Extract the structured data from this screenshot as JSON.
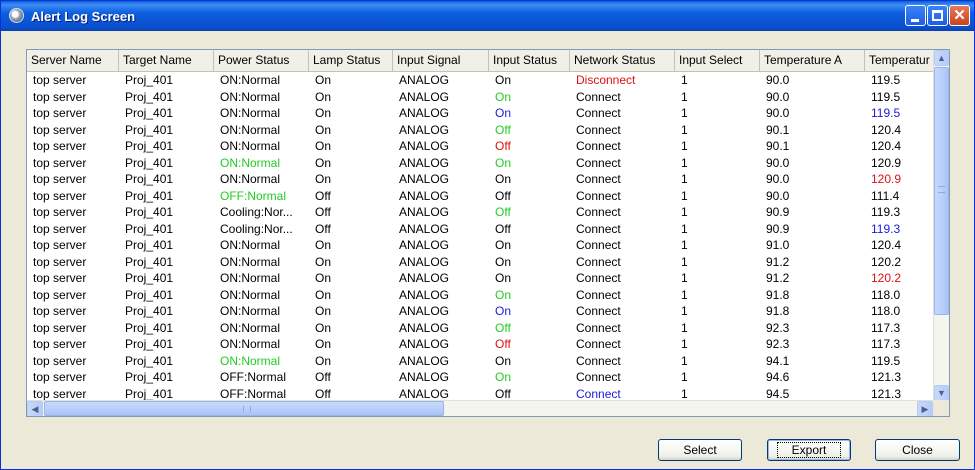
{
  "window": {
    "title": "Alert Log Screen"
  },
  "columns": [
    "Server Name",
    "Target Name",
    "Power Status",
    "Lamp Status",
    "Input Signal",
    "Input Status",
    "Network Status",
    "Input Select",
    "Temperature A",
    "Temperatur"
  ],
  "rows": [
    [
      "top server",
      "Proj_401",
      "ON:Normal",
      "On",
      "ANALOG",
      "On",
      "Disconnect",
      "1",
      "90.0",
      "119.5"
    ],
    [
      "top server",
      "Proj_401",
      "ON:Normal",
      "On",
      "ANALOG",
      "On",
      "Connect",
      "1",
      "90.0",
      "119.5"
    ],
    [
      "top server",
      "Proj_401",
      "ON:Normal",
      "On",
      "ANALOG",
      "On",
      "Connect",
      "1",
      "90.0",
      "119.5"
    ],
    [
      "top server",
      "Proj_401",
      "ON:Normal",
      "On",
      "ANALOG",
      "Off",
      "Connect",
      "1",
      "90.1",
      "120.4"
    ],
    [
      "top server",
      "Proj_401",
      "ON:Normal",
      "On",
      "ANALOG",
      "Off",
      "Connect",
      "1",
      "90.1",
      "120.4"
    ],
    [
      "top server",
      "Proj_401",
      "ON:Normal",
      "On",
      "ANALOG",
      "On",
      "Connect",
      "1",
      "90.0",
      "120.9"
    ],
    [
      "top server",
      "Proj_401",
      "ON:Normal",
      "On",
      "ANALOG",
      "On",
      "Connect",
      "1",
      "90.0",
      "120.9"
    ],
    [
      "top server",
      "Proj_401",
      "OFF:Normal",
      "Off",
      "ANALOG",
      "Off",
      "Connect",
      "1",
      "90.0",
      "111.4"
    ],
    [
      "top server",
      "Proj_401",
      "Cooling:Nor...",
      "Off",
      "ANALOG",
      "Off",
      "Connect",
      "1",
      "90.9",
      "119.3"
    ],
    [
      "top server",
      "Proj_401",
      "Cooling:Nor...",
      "Off",
      "ANALOG",
      "Off",
      "Connect",
      "1",
      "90.9",
      "119.3"
    ],
    [
      "top server",
      "Proj_401",
      "ON:Normal",
      "On",
      "ANALOG",
      "On",
      "Connect",
      "1",
      "91.0",
      "120.4"
    ],
    [
      "top server",
      "Proj_401",
      "ON:Normal",
      "On",
      "ANALOG",
      "On",
      "Connect",
      "1",
      "91.2",
      "120.2"
    ],
    [
      "top server",
      "Proj_401",
      "ON:Normal",
      "On",
      "ANALOG",
      "On",
      "Connect",
      "1",
      "91.2",
      "120.2"
    ],
    [
      "top server",
      "Proj_401",
      "ON:Normal",
      "On",
      "ANALOG",
      "On",
      "Connect",
      "1",
      "91.8",
      "118.0"
    ],
    [
      "top server",
      "Proj_401",
      "ON:Normal",
      "On",
      "ANALOG",
      "On",
      "Connect",
      "1",
      "91.8",
      "118.0"
    ],
    [
      "top server",
      "Proj_401",
      "ON:Normal",
      "On",
      "ANALOG",
      "Off",
      "Connect",
      "1",
      "92.3",
      "117.3"
    ],
    [
      "top server",
      "Proj_401",
      "ON:Normal",
      "On",
      "ANALOG",
      "Off",
      "Connect",
      "1",
      "92.3",
      "117.3"
    ],
    [
      "top server",
      "Proj_401",
      "ON:Normal",
      "On",
      "ANALOG",
      "On",
      "Connect",
      "1",
      "94.1",
      "119.5"
    ],
    [
      "top server",
      "Proj_401",
      "OFF:Normal",
      "Off",
      "ANALOG",
      "On",
      "Connect",
      "1",
      "94.6",
      "121.3"
    ],
    [
      "top server",
      "Proj_401",
      "OFF:Normal",
      "Off",
      "ANALOG",
      "Off",
      "Connect",
      "1",
      "94.5",
      "121.3"
    ]
  ],
  "highlights": {
    "0": {
      "6": "red"
    },
    "1": {
      "5": "green"
    },
    "2": {
      "5": "blue",
      "9": "blue"
    },
    "3": {
      "5": "green"
    },
    "4": {
      "5": "red"
    },
    "5": {
      "2": "green",
      "5": "green"
    },
    "6": {
      "9": "red"
    },
    "7": {
      "2": "green"
    },
    "8": {
      "5": "green"
    },
    "9": {
      "9": "blue"
    },
    "12": {
      "9": "red"
    },
    "13": {
      "5": "green"
    },
    "14": {
      "5": "blue"
    },
    "15": {
      "5": "green"
    },
    "16": {
      "5": "red"
    },
    "17": {
      "2": "green"
    },
    "18": {
      "5": "green"
    },
    "19": {
      "6": "blue"
    }
  },
  "colors": {
    "red": "#e01010",
    "green": "#22cc22",
    "blue": "#1a1ae0"
  },
  "buttons": {
    "select": "Select",
    "export": "Export",
    "close": "Close"
  }
}
